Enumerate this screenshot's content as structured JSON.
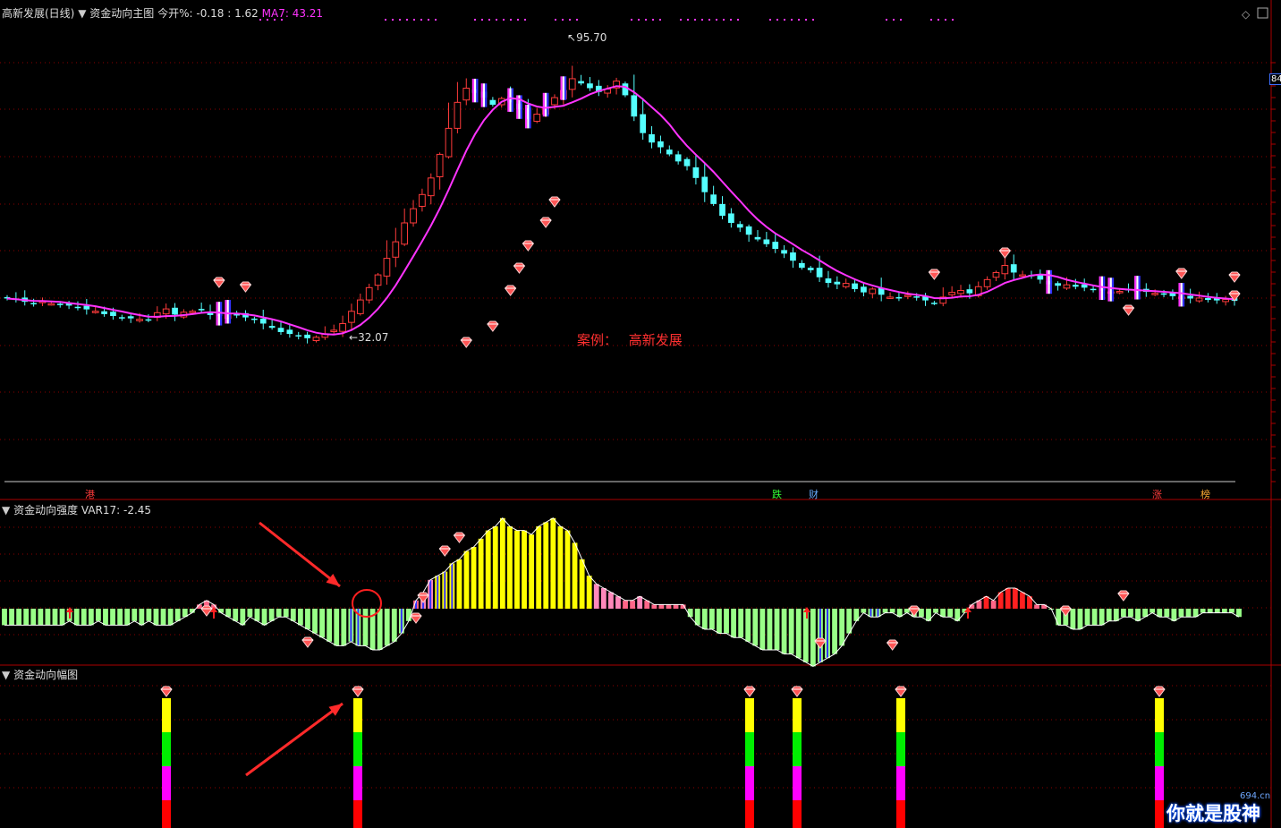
{
  "header": {
    "stock_name": "高新发展(日线)",
    "main_indicator": "资金动向主图",
    "today_open": "今开%: -0.18 : 1.62",
    "ma7": "MA7: 43.21"
  },
  "panels": {
    "strength_title": "资金动向强度",
    "strength_value": "VAR17: -2.45",
    "amplitude_title": "资金动向幅图"
  },
  "annotations": {
    "high_label": "95.70",
    "low_label": "32.07",
    "case_label": "案例：",
    "case_name": "高新发展",
    "right_price": "84"
  },
  "event_labels": [
    "港",
    "跌",
    "财",
    "涨",
    "榜"
  ],
  "watermark": {
    "domain": "694.cn",
    "text": "你就是股神"
  },
  "colors": {
    "up": "#ff3b3b",
    "down": "#54ffff",
    "ma": "#ff33ff",
    "bull": "#ffff00",
    "bear": "#99ff88",
    "grid": "#8b0000",
    "blue": "#3333ff"
  },
  "chart_data": {
    "type": "candlestick",
    "title": "高新发展(日线)",
    "price_high": 95.7,
    "price_low": 32.07,
    "ma7_last": 43.21,
    "var17_last": -2.45,
    "closes": [
      40.5,
      40.2,
      39.8,
      39.5,
      39.9,
      39.4,
      39.1,
      39.0,
      38.7,
      38.2,
      37.8,
      37.2,
      36.8,
      36.5,
      36.3,
      36.1,
      36.0,
      37.5,
      38.3,
      37.1,
      37.6,
      37.8,
      38.0,
      37.0,
      36.8,
      37.2,
      36.9,
      36.5,
      36.0,
      35.2,
      34.3,
      33.4,
      33.0,
      32.6,
      32.1,
      32.3,
      33.0,
      33.8,
      35.2,
      37.8,
      40.2,
      42.8,
      45.5,
      49.0,
      52.5,
      56.5,
      59.5,
      62.5,
      66.0,
      71.0,
      76.5,
      82.0,
      85.0,
      84.0,
      83.0,
      81.5,
      82.8,
      82.0,
      80.5,
      78.5,
      79.5,
      81.0,
      83.0,
      84.5,
      87.0,
      86.0,
      85.0,
      84.2,
      84.8,
      86.5,
      83.5,
      79.0,
      75.5,
      73.5,
      72.5,
      71.0,
      69.5,
      68.5,
      66.0,
      63.0,
      60.5,
      58.0,
      56.5,
      55.5,
      54.0,
      53.0,
      52.0,
      51.0,
      50.0,
      48.5,
      47.0,
      46.5,
      45.0,
      43.8,
      43.5,
      43.7,
      42.5,
      41.8,
      42.5,
      41.3,
      40.8,
      40.5,
      41.2,
      40.8,
      40.1,
      39.5,
      40.8,
      41.8,
      42.2,
      41.6,
      43.0,
      44.5,
      46.0,
      47.5,
      46.0,
      45.5,
      45.2,
      44.5,
      43.5,
      43.2,
      43.4,
      43.0,
      42.8,
      42.5,
      42.2,
      41.9,
      42.0,
      42.4,
      42.3,
      41.9,
      41.6,
      41.3,
      41.0,
      40.8,
      40.5,
      40.6,
      40.2,
      40.1,
      40.3,
      40.0
    ],
    "strength_values": [
      -4,
      -4,
      -4,
      -4,
      -4,
      -4,
      -4,
      -4,
      -4,
      -3,
      -4,
      -4,
      -4,
      -3,
      -4,
      -4,
      -4,
      -4,
      -3,
      -4,
      -3,
      -4,
      -4,
      -4,
      -3,
      -2,
      -1,
      1,
      2,
      1,
      -1,
      -2,
      -3,
      -4,
      -2,
      -3,
      -4,
      -3,
      -2,
      -2,
      -3,
      -4,
      -5,
      -6,
      -7,
      -8,
      -9,
      -9,
      -8,
      -9,
      -9,
      -10,
      -10,
      -9,
      -8,
      -6,
      -3,
      2,
      4,
      7,
      8,
      9,
      11,
      12,
      14,
      15,
      17,
      19,
      20,
      22,
      20,
      19,
      19,
      18,
      20,
      21,
      22,
      20,
      19,
      16,
      12,
      8,
      6,
      5,
      4,
      3,
      2,
      2,
      3,
      2,
      1,
      1,
      1,
      1,
      1,
      -2,
      -4,
      -5,
      -5,
      -6,
      -6,
      -7,
      -7,
      -8,
      -9,
      -10,
      -10,
      -10,
      -11,
      -11,
      -12,
      -13,
      -14,
      -13,
      -12,
      -11,
      -9,
      -6,
      -3,
      -1,
      -2,
      -2,
      -1,
      -1,
      -2,
      -1,
      -2,
      -2,
      -3,
      -1,
      -2,
      -2,
      -3,
      -1,
      1,
      2,
      3,
      2,
      4,
      5,
      5,
      4,
      3,
      1,
      1,
      0,
      -4,
      -4,
      -5,
      -5,
      -4,
      -4,
      -4,
      -3,
      -3,
      -2,
      -2,
      -3,
      -2,
      -1,
      -2,
      -2,
      -3,
      -2,
      -2,
      -2,
      -1,
      -1,
      -1,
      -1,
      -1,
      -2
    ],
    "amplitude_signal_days": [
      52,
      109,
      113,
      127,
      151
    ],
    "amplitude_segment_colors": [
      "#ffff00",
      "#00ee00",
      "#ff00ff",
      "#ff0000"
    ]
  }
}
